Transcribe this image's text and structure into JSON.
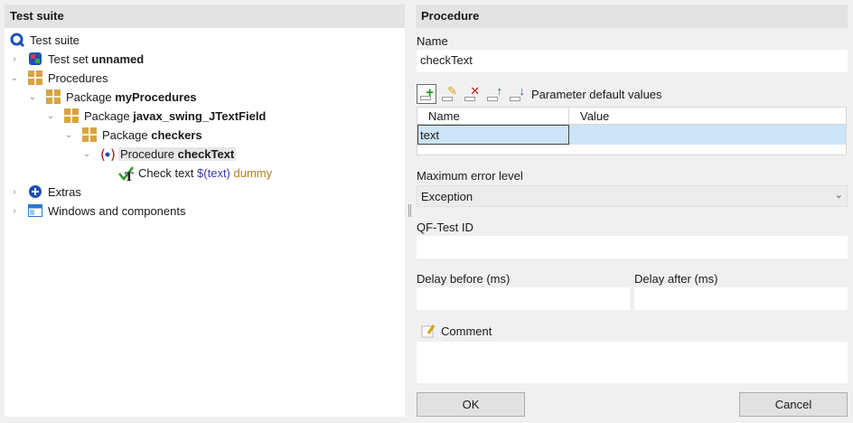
{
  "left": {
    "header": "Test suite",
    "tree": {
      "root": "Test suite",
      "testset_prefix": "Test set",
      "testset_name": "unnamed",
      "procedures": "Procedures",
      "pkg1_prefix": "Package",
      "pkg1_name": "myProcedures",
      "pkg2_prefix": "Package",
      "pkg2_name": "javax_swing_JTextField",
      "pkg3_prefix": "Package",
      "pkg3_name": "checkers",
      "proc_prefix": "Procedure",
      "proc_name": "checkText",
      "check_prefix": "Check text",
      "check_var": "$(text)",
      "check_dummy": "dummy",
      "extras": "Extras",
      "windows": "Windows and components"
    }
  },
  "right": {
    "header": "Procedure",
    "name_label": "Name",
    "name_value": "checkText",
    "params_title": "Parameter default values",
    "table": {
      "headers": [
        "Name",
        "Value"
      ],
      "rows": [
        [
          "text",
          ""
        ]
      ]
    },
    "max_error_label": "Maximum error level",
    "max_error_value": "Exception",
    "qfid_label": "QF-Test ID",
    "qfid_value": "",
    "delay_before_label": "Delay before (ms)",
    "delay_before_value": "",
    "delay_after_label": "Delay after (ms)",
    "delay_after_value": "",
    "comment_label": "Comment",
    "comment_value": "",
    "ok_label": "OK",
    "cancel_label": "Cancel"
  },
  "icons": {
    "root": "qftest-q-icon",
    "testset": "testset-icon",
    "package": "package-icon",
    "procedure": "procedure-icon",
    "check": "check-text-icon",
    "extras": "extras-plus-icon",
    "windows": "window-icon"
  },
  "colors": {
    "accent_blue": "#1e50b4",
    "package_gold": "#d8a440",
    "selection_blue": "#cce4f7",
    "variable": "#3a3ab0",
    "dummy": "#b08020"
  }
}
